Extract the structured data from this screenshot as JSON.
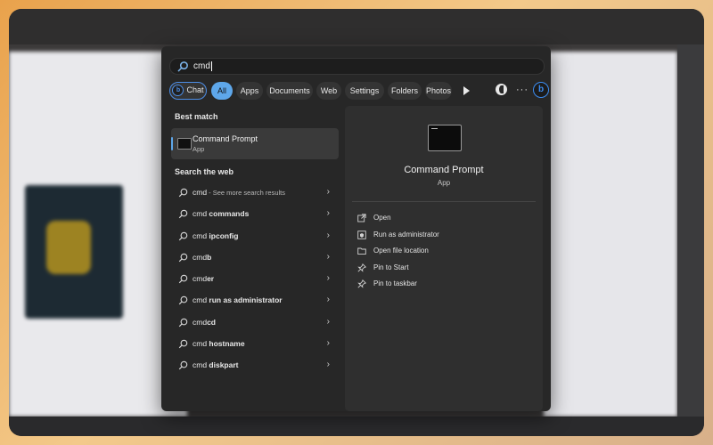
{
  "search": {
    "value": "cmd"
  },
  "filters": [
    {
      "label": "Chat"
    },
    {
      "label": "All"
    },
    {
      "label": "Apps"
    },
    {
      "label": "Documents"
    },
    {
      "label": "Web"
    },
    {
      "label": "Settings"
    },
    {
      "label": "Folders"
    },
    {
      "label": "Photos"
    }
  ],
  "bing_letter": "b",
  "sections": {
    "best_match": "Best match",
    "search_web": "Search the web"
  },
  "best_match": {
    "title": "Command Prompt",
    "subtitle": "App"
  },
  "web_results": [
    {
      "query": "cmd",
      "suffix": " - See more search results"
    },
    {
      "query": "cmd ",
      "bold": "commands"
    },
    {
      "query": "cmd ",
      "bold": "ipconfig"
    },
    {
      "query": "cmd",
      "bold": "b"
    },
    {
      "query": "cmd",
      "bold": "er"
    },
    {
      "query": "cmd ",
      "bold": "run as administrator"
    },
    {
      "query": "cmd",
      "bold": "cd"
    },
    {
      "query": "cmd ",
      "bold": "hostname"
    },
    {
      "query": "cmd ",
      "bold": "diskpart"
    }
  ],
  "detail": {
    "name": "Command Prompt",
    "type": "App",
    "actions": [
      {
        "label": "Open",
        "icon": "open-external-icon"
      },
      {
        "label": "Run as administrator",
        "icon": "shield-window-icon"
      },
      {
        "label": "Open file location",
        "icon": "folder-icon"
      },
      {
        "label": "Pin to Start",
        "icon": "pin-icon"
      },
      {
        "label": "Pin to taskbar",
        "icon": "pin-icon"
      }
    ]
  },
  "colors": {
    "accent": "#5ea7ea",
    "bing": "#3c8df2",
    "panel": "#272727"
  }
}
